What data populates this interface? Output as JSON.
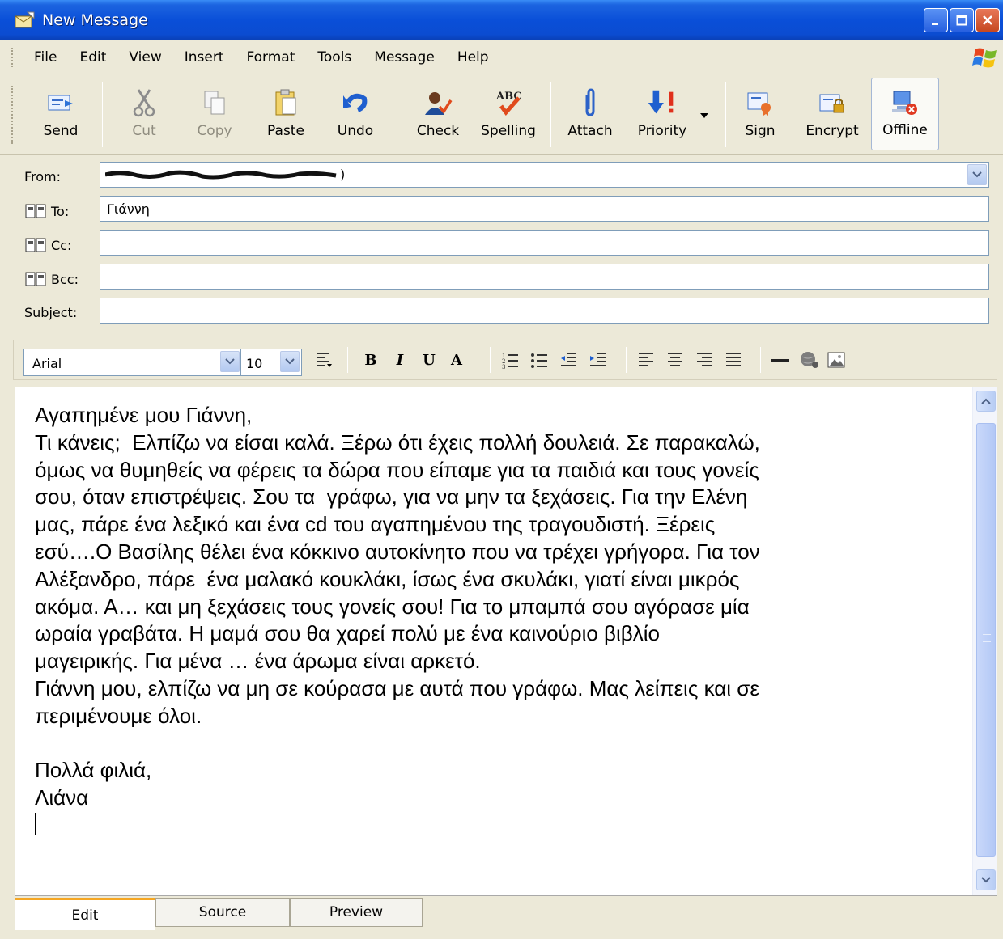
{
  "window": {
    "title": "New Message",
    "buttons": [
      "minimize",
      "maximize",
      "close"
    ]
  },
  "menu": {
    "items": [
      "File",
      "Edit",
      "View",
      "Insert",
      "Format",
      "Tools",
      "Message",
      "Help"
    ]
  },
  "toolbar": {
    "send": "Send",
    "cut": "Cut",
    "copy": "Copy",
    "paste": "Paste",
    "undo": "Undo",
    "check": "Check",
    "spelling": "Spelling",
    "spelling_glyph": "ABC",
    "attach": "Attach",
    "priority": "Priority",
    "sign": "Sign",
    "encrypt": "Encrypt",
    "offline": "Offline"
  },
  "headers": {
    "from_label": "From:",
    "from_value_visible": ")",
    "to_label": "To:",
    "to_value": "Γιάννη",
    "cc_label": "Cc:",
    "cc_value": "",
    "bcc_label": "Bcc:",
    "bcc_value": "",
    "subject_label": "Subject:",
    "subject_value": ""
  },
  "format": {
    "font": "Arial",
    "size": "10",
    "bold": "B",
    "italic": "I",
    "underline": "U",
    "font_color": "A"
  },
  "body": {
    "text": "Αγαπημένε μου Γιάννη,\nΤι κάνεις;  Ελπίζω να είσαι καλά. Ξέρω ότι έχεις πολλή δουλειά. Σε παρακαλώ,\nόμως να θυμηθείς να φέρεις τα δώρα που είπαμε για τα παιδιά και τους γονείς\nσου, όταν επιστρέψεις. Σου τα  γράφω, για να μην τα ξεχάσεις. Για την Ελένη\nμας, πάρε ένα λεξικό και ένα cd του αγαπημένου της τραγουδιστή. Ξέρεις\nεσύ….Ο Βασίλης θέλει ένα κόκκινο αυτοκίνητο που να τρέχει γρήγορα. Για τον\nΑλέξανδρο, πάρε  ένα μαλακό κουκλάκι, ίσως ένα σκυλάκι, γιατί είναι μικρός\nακόμα. Α… και μη ξεχάσεις τους γονείς σου! Για το μπαμπά σου αγόρασε μία\nωραία γραβάτα. Η μαμά σου θα χαρεί πολύ με ένα καινούριο βιβλίο\nμαγειρικής. Για μένα … ένα άρωμα είναι αρκετό.\nΓιάννη μου, ελπίζω να μη σε κούρασα με αυτά που γράφω. Μας λείπεις και σε\nπεριμένουμε όλοι.\n\nΠολλά φιλιά,\nΛιάνα\n"
  },
  "tabs": {
    "edit": "Edit",
    "source": "Source",
    "preview": "Preview",
    "active": "Edit"
  },
  "colors": {
    "titlebar": "#0a4fd8",
    "chrome": "#ece9d8",
    "field_border": "#7f9db9",
    "active_tab_accent": "#f5a623"
  }
}
